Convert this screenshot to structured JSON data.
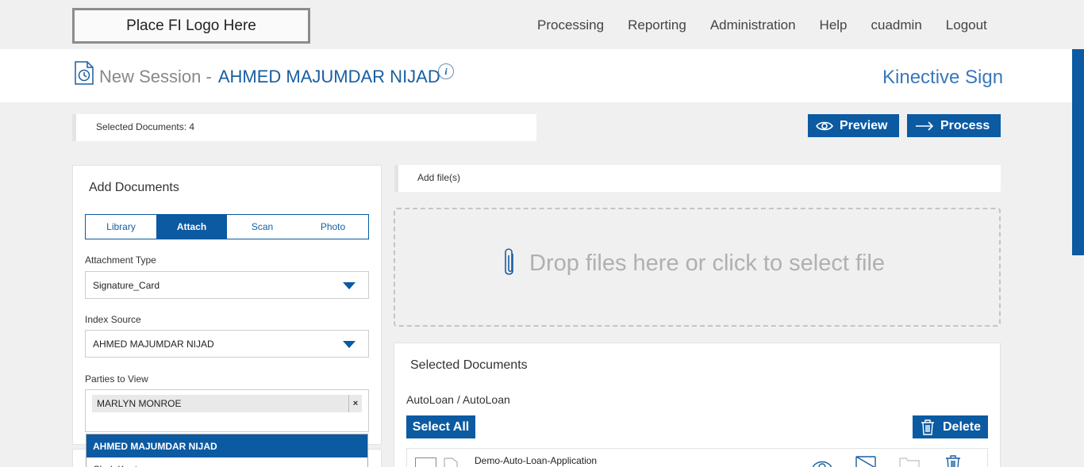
{
  "topbar": {
    "logo_text": "Place FI Logo Here",
    "nav": [
      "Processing",
      "Reporting",
      "Administration",
      "Help",
      "cuadmin",
      "Logout"
    ]
  },
  "header": {
    "session_label": "New Session -",
    "party_name": "AHMED MAJUMDAR NIJAD",
    "info_icon": "i",
    "brand": "Kinective Sign"
  },
  "toolbar": {
    "selected_documents": "Selected Documents: 4",
    "preview_label": "Preview",
    "process_label": "Process"
  },
  "add_documents": {
    "title": "Add Documents",
    "tabs": [
      {
        "label": "Library",
        "active": false
      },
      {
        "label": "Attach",
        "active": true
      },
      {
        "label": "Scan",
        "active": false
      },
      {
        "label": "Photo",
        "active": false
      }
    ],
    "attachment_type_label": "Attachment Type",
    "attachment_type_value": "Signature_Card",
    "index_source_label": "Index Source",
    "index_source_value": "AHMED MAJUMDAR NIJAD",
    "parties_label": "Parties to View",
    "parties_chip": "MARLYN MONROE",
    "chip_remove": "×",
    "dropdown_options": [
      "AHMED MAJUMDAR NIJAD",
      "Clark Kent"
    ]
  },
  "upload": {
    "add_files_label": "Add file(s)",
    "dropzone_text": "Drop files here or click to select file"
  },
  "selected_documents": {
    "title": "Selected Documents",
    "group": "AutoLoan / AutoLoan",
    "select_all_label": "Select All",
    "delete_label": "Delete",
    "rows": [
      {
        "name": "Demo-Auto-Loan-Application"
      }
    ]
  },
  "colors": {
    "accent": "#0b5aa2",
    "brand_text": "#3a78b8",
    "background": "#f0f0f0"
  },
  "icons": [
    "history-icon",
    "info-icon",
    "eye-icon",
    "arrow-right-icon",
    "paperclip-icon",
    "trash-icon",
    "file-icon",
    "edit-icon",
    "folder-icon"
  ]
}
